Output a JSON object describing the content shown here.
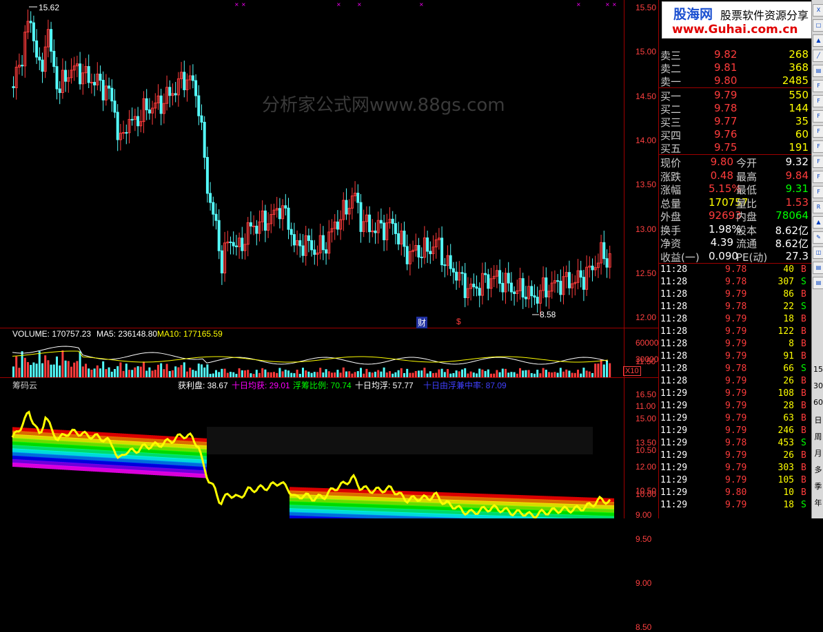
{
  "colors": {
    "up": "#ff3c3c",
    "down": "#54fcfc",
    "axis": "#ff4040",
    "divider": "#a00000",
    "white": "#ffffff",
    "yellow": "#ffff00",
    "green": "#00ff00",
    "magenta": "#ff00ff",
    "blue": "#4040ff"
  },
  "kline_panel": {
    "high_label": "15.62",
    "low_label": "8.58",
    "watermark": "分析家公式网www.88gs.com",
    "markers": [
      "财",
      "$"
    ],
    "axis_ticks": [
      "15.50",
      "15.00",
      "14.50",
      "14.00",
      "13.50",
      "13.00",
      "12.50",
      "12.00",
      "11.50",
      "11.00",
      "10.50",
      "10.00",
      "9.50",
      "9.00",
      "8.50"
    ]
  },
  "volume_panel": {
    "volume_label": "VOLUME: 170757.23",
    "ma5_label": "MA5: 236148.80",
    "ma10_label": "MA10: 177165.59",
    "axis_ticks": [
      "60000",
      "30000"
    ],
    "unit": "X10"
  },
  "chip_panel": {
    "title": "筹码云",
    "profit_label": "获利盘: 38.67",
    "avg_profit_label": "十日均获: 29.01",
    "float_ratio_label": "浮筹比例: 70.74",
    "avg_float_label": "十日均浮: 57.77",
    "concentration_label": "十日由浮兼中率: 87.09",
    "axis_ticks": [
      "16.50",
      "15.00",
      "13.50",
      "12.00",
      "10.50",
      "9.00"
    ]
  },
  "logo": {
    "title": "股海网",
    "tagline": "股票软件资源分享",
    "url": "www.Guhai.com.cn"
  },
  "order_book": {
    "asks": [
      {
        "label": "卖三",
        "price": "9.82",
        "vol": "268"
      },
      {
        "label": "卖二",
        "price": "9.81",
        "vol": "368"
      },
      {
        "label": "卖一",
        "price": "9.80",
        "vol": "2485"
      }
    ],
    "bids": [
      {
        "label": "买一",
        "price": "9.79",
        "vol": "550"
      },
      {
        "label": "买二",
        "price": "9.78",
        "vol": "144"
      },
      {
        "label": "买三",
        "price": "9.77",
        "vol": "35"
      },
      {
        "label": "买四",
        "price": "9.76",
        "vol": "60"
      },
      {
        "label": "买五",
        "price": "9.75",
        "vol": "191"
      }
    ]
  },
  "quote": [
    {
      "l1": "现价",
      "v1": "9.80",
      "l2": "今开",
      "v2": "9.32",
      "c1": "#ff3c3c",
      "c2": "#ffffff"
    },
    {
      "l1": "涨跌",
      "v1": "0.48",
      "l2": "最高",
      "v2": "9.84",
      "c1": "#ff3c3c",
      "c2": "#ff3c3c"
    },
    {
      "l1": "涨幅",
      "v1": "5.15%",
      "l2": "最低",
      "v2": "9.31",
      "c1": "#ff3c3c",
      "c2": "#00ff00"
    },
    {
      "l1": "总量",
      "v1": "170757",
      "l2": "量比",
      "v2": "1.53",
      "c1": "#ffff00",
      "c2": "#ff3c3c"
    },
    {
      "l1": "外盘",
      "v1": "92693",
      "l2": "内盘",
      "v2": "78064",
      "c1": "#ff3c3c",
      "c2": "#00ff00"
    },
    {
      "l1": "换手",
      "v1": "1.98%",
      "l2": "股本",
      "v2": "8.62亿",
      "c1": "#ffffff",
      "c2": "#ffffff"
    },
    {
      "l1": "净资",
      "v1": "4.39",
      "l2": "流通",
      "v2": "8.62亿",
      "c1": "#ffffff",
      "c2": "#ffffff"
    },
    {
      "l1": "收益(一)",
      "v1": "0.090",
      "l2": "PE(动)",
      "v2": "27.3",
      "c1": "#ffffff",
      "c2": "#ffffff"
    }
  ],
  "ticks": [
    {
      "t": "11:28",
      "p": "9.78",
      "v": "40",
      "s": "B"
    },
    {
      "t": "11:28",
      "p": "9.78",
      "v": "307",
      "s": "S"
    },
    {
      "t": "11:28",
      "p": "9.79",
      "v": "86",
      "s": "B"
    },
    {
      "t": "11:28",
      "p": "9.78",
      "v": "22",
      "s": "S"
    },
    {
      "t": "11:28",
      "p": "9.79",
      "v": "18",
      "s": "B"
    },
    {
      "t": "11:28",
      "p": "9.79",
      "v": "122",
      "s": "B"
    },
    {
      "t": "11:28",
      "p": "9.79",
      "v": "8",
      "s": "B"
    },
    {
      "t": "11:28",
      "p": "9.79",
      "v": "91",
      "s": "B"
    },
    {
      "t": "11:28",
      "p": "9.78",
      "v": "66",
      "s": "S"
    },
    {
      "t": "11:28",
      "p": "9.79",
      "v": "26",
      "s": "B"
    },
    {
      "t": "11:29",
      "p": "9.79",
      "v": "108",
      "s": "B"
    },
    {
      "t": "11:29",
      "p": "9.79",
      "v": "28",
      "s": "B"
    },
    {
      "t": "11:29",
      "p": "9.79",
      "v": "63",
      "s": "B"
    },
    {
      "t": "11:29",
      "p": "9.79",
      "v": "246",
      "s": "B"
    },
    {
      "t": "11:29",
      "p": "9.78",
      "v": "453",
      "s": "S"
    },
    {
      "t": "11:29",
      "p": "9.79",
      "v": "26",
      "s": "B"
    },
    {
      "t": "11:29",
      "p": "9.79",
      "v": "303",
      "s": "B"
    },
    {
      "t": "11:29",
      "p": "9.79",
      "v": "105",
      "s": "B"
    },
    {
      "t": "11:29",
      "p": "9.80",
      "v": "10",
      "s": "B"
    },
    {
      "t": "11:29",
      "p": "9.79",
      "v": "18",
      "s": "S"
    }
  ],
  "toolbar_numbers": [
    "15",
    "30",
    "60",
    "日",
    "周",
    "月",
    "多",
    "季",
    "年"
  ]
}
